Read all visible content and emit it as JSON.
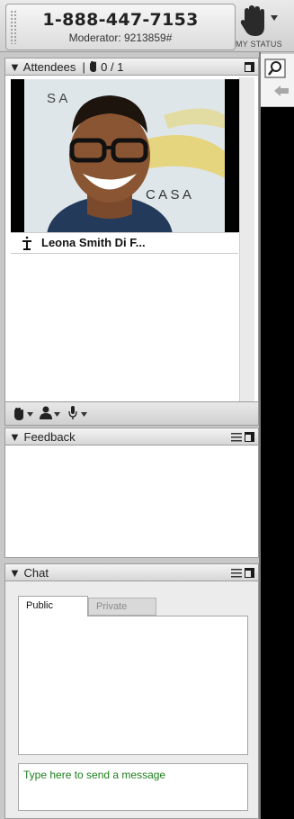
{
  "conference": {
    "phone": "1-888-447-7153",
    "moderator": "Moderator: 9213859#"
  },
  "status": {
    "label": "MY STATUS"
  },
  "attendees": {
    "title": "Attendees",
    "count": "0 / 1",
    "list": [
      {
        "name": "Leona Smith Di F...",
        "role_icon": "presenter-podium-icon"
      }
    ],
    "photo_text": {
      "left_logo": "S A",
      "right_logo": "C A S A"
    }
  },
  "feedback": {
    "title": "Feedback"
  },
  "chat": {
    "title": "Chat",
    "tabs": [
      "Public",
      "Private"
    ],
    "active_tab": "Public",
    "input_placeholder": "Type here to send a message"
  },
  "icons": [
    "raise-hand-icon",
    "dropdown-arrow-icon",
    "grip-icon",
    "maximize-icon",
    "list-icon",
    "person-icon",
    "microphone-icon",
    "back-arrow-icon",
    "magnify-icon"
  ],
  "colors": {
    "chat_placeholder": "#1c7f1c",
    "right_panel_bg": "#000000"
  }
}
